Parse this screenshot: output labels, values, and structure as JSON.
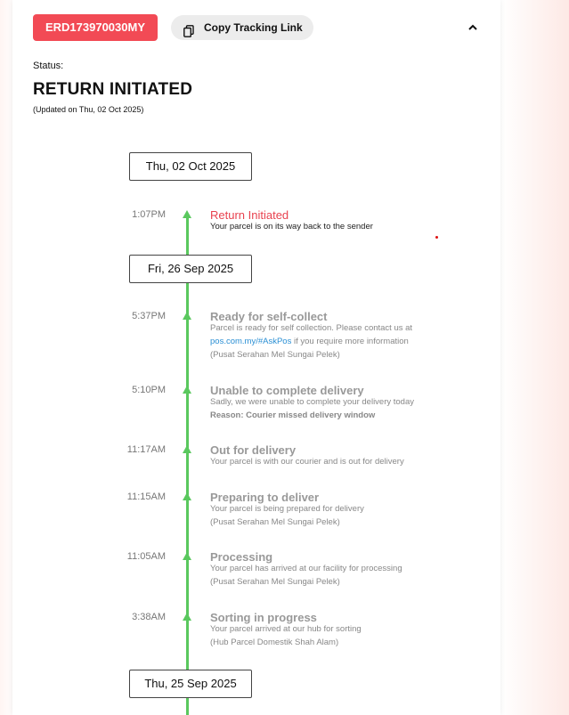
{
  "header": {
    "tracking_number": "ERD173970030MY",
    "copy_link_label": "Copy Tracking Link"
  },
  "status": {
    "label": "Status:",
    "value": "RETURN INITIATED",
    "updated": "(Updated on Thu, 02 Oct 2025)"
  },
  "dates": [
    "Thu, 02 Oct 2025",
    "Fri, 26 Sep 2025",
    "Thu, 25 Sep 2025"
  ],
  "events": [
    {
      "time": "1:07PM",
      "title": "Return Initiated",
      "desc": "Your parcel is on its way back to the sender"
    },
    {
      "time": "5:37PM",
      "title": "Ready for self-collect",
      "desc1": "Parcel is ready for self collection. Please contact us at",
      "link": "pos.com.my/#AskPos",
      "desc2": " if you require more information",
      "location": "(Pusat Serahan Mel Sungai Pelek)"
    },
    {
      "time": "5:10PM",
      "title": "Unable to complete delivery",
      "desc": "Sadly, we were unable to complete your delivery today",
      "reason": "Reason: Courier missed delivery window"
    },
    {
      "time": "11:17AM",
      "title": "Out for delivery",
      "desc": "Your parcel is with our courier and is out for delivery"
    },
    {
      "time": "11:15AM",
      "title": "Preparing to deliver",
      "desc": "Your parcel is being prepared for delivery",
      "location": "(Pusat Serahan Mel Sungai Pelek)"
    },
    {
      "time": "11:05AM",
      "title": "Processing",
      "desc": "Your parcel has arrived at our facility for processing",
      "location": "(Pusat Serahan Mel Sungai Pelek)"
    },
    {
      "time": "3:38AM",
      "title": "Sorting in progress",
      "desc": "Your parcel arrived at our hub for sorting",
      "location": "(Hub Parcel Domestik Shah Alam)"
    }
  ],
  "colors": {
    "accent_red": "#f24a55",
    "timeline_green": "#5ac85e",
    "link_blue": "#2a8fd4"
  },
  "icons": {
    "copy": "copy-icon",
    "collapse": "chevron-up-icon"
  }
}
